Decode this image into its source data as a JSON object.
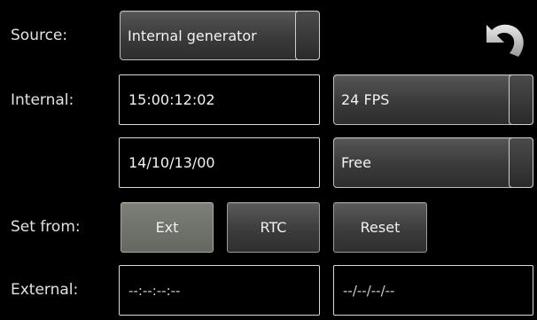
{
  "labels": {
    "source": "Source:",
    "internal": "Internal:",
    "set_from": "Set from:",
    "external": "External:"
  },
  "source": {
    "selected": "Internal generator"
  },
  "internal": {
    "timecode": "15:00:12:02",
    "userbits": "14/10/13/00",
    "frame_rate": "24 FPS",
    "run_mode": "Free"
  },
  "set_from": {
    "ext_label": "Ext",
    "rtc_label": "RTC",
    "reset_label": "Reset",
    "active": "Ext"
  },
  "external": {
    "timecode": "--:--:--:--",
    "userbits": "--/--/--/--"
  },
  "icons": {
    "undo": "undo-icon"
  }
}
